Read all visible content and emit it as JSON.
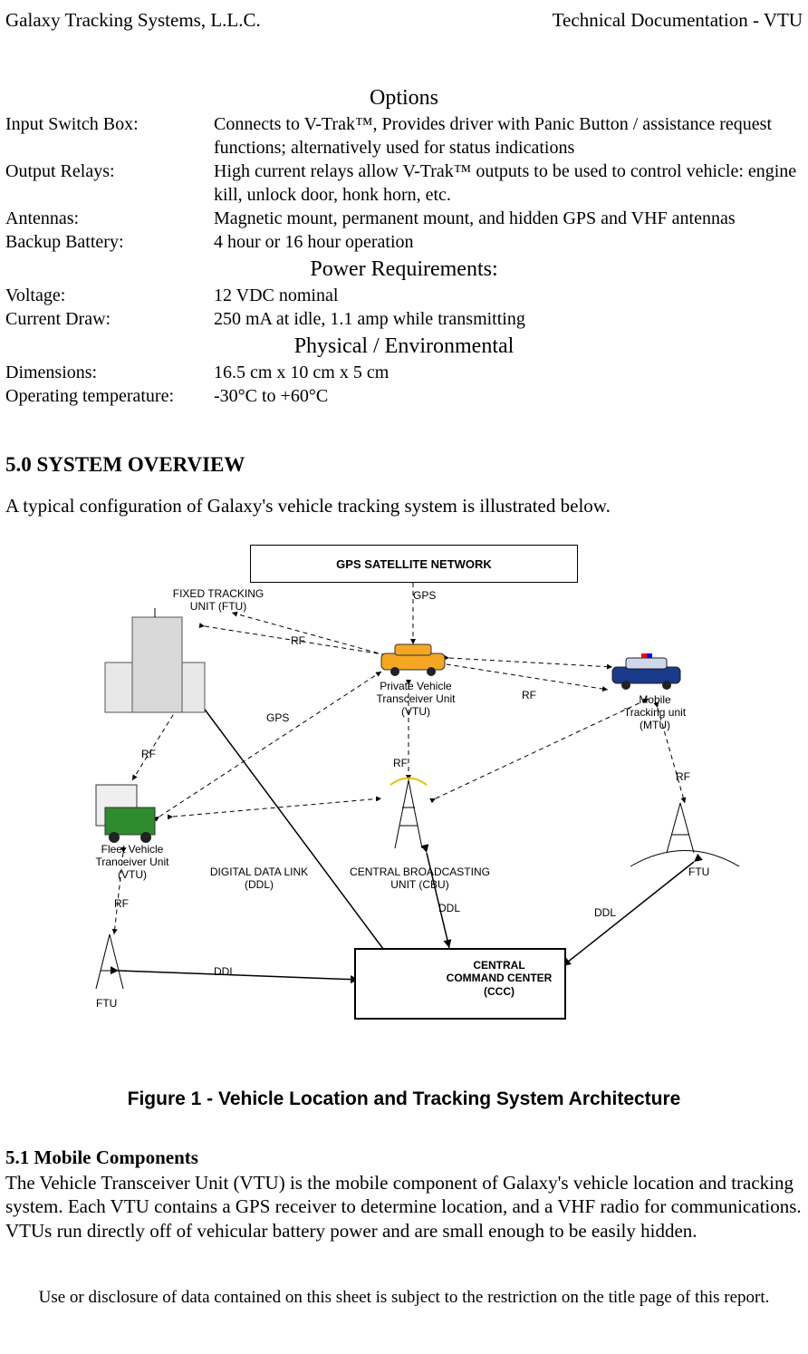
{
  "header": {
    "left": "Galaxy Tracking Systems, L.L.C.",
    "right": "Technical Documentation - VTU"
  },
  "sections": {
    "options_title": "Options",
    "power_title": "Power Requirements:",
    "physical_title": "Physical / Environmental"
  },
  "specs": {
    "input_switch_label": "Input Switch Box:",
    "input_switch_value": "Connects to V-Trak™, Provides driver with Panic Button / assistance request functions; alternatively used for status indications",
    "output_relays_label": "Output Relays:",
    "output_relays_value": "High current relays allow V-Trak™ outputs to be used to control vehicle: engine kill, unlock door, honk horn, etc.",
    "antennas_label": "Antennas:",
    "antennas_value": "Magnetic mount, permanent mount, and hidden GPS and VHF antennas",
    "backup_battery_label": "Backup Battery:",
    "backup_battery_value": "4 hour or 16 hour operation",
    "voltage_label": "Voltage:",
    "voltage_value": "12 VDC nominal",
    "current_label": "Current Draw:",
    "current_value": "250 mA at idle, 1.1 amp while transmitting",
    "dimensions_label": "Dimensions:",
    "dimensions_value": "16.5 cm x 10 cm x 5 cm",
    "temp_label": "Operating temperature:",
    "temp_value": "-30°C to +60°C"
  },
  "overview": {
    "heading": "5.0 SYSTEM OVERVIEW",
    "intro": "A typical configuration of Galaxy's vehicle tracking system is illustrated below."
  },
  "diagram": {
    "gps_box": "GPS SATELLITE NETWORK",
    "ftu_label": "FIXED TRACKING UNIT (FTU)",
    "vtu_label": "Private Vehicle Transceiver Unit (VTU)",
    "mtu_label": "Mobile Tracking unit (MTU)",
    "fleet_label": "Fleet Vehicle Tranceiver Unit (VTU)",
    "ddl_label": "DIGITAL DATA LINK  (DDL)",
    "cbu_label": "CENTRAL BROADCASTING UNIT (CBU)",
    "ccc_label": "CENTRAL COMMAND CENTER (CCC)",
    "ftu_small": "FTU",
    "gps": "GPS",
    "rf": "RF",
    "ddl": "DDL"
  },
  "figure_caption": "Figure 1 - Vehicle Location and Tracking System Architecture",
  "mobile": {
    "heading": "5.1 Mobile Components",
    "body": "The Vehicle Transceiver Unit (VTU) is the mobile component of Galaxy's vehicle location and tracking system. Each VTU contains a GPS receiver to determine location, and a VHF radio for communications. VTUs run directly off of vehicular battery power and are small enough to be easily hidden."
  },
  "footer": "Use or disclosure of data contained on this sheet is subject to the restriction on the title page of this report."
}
